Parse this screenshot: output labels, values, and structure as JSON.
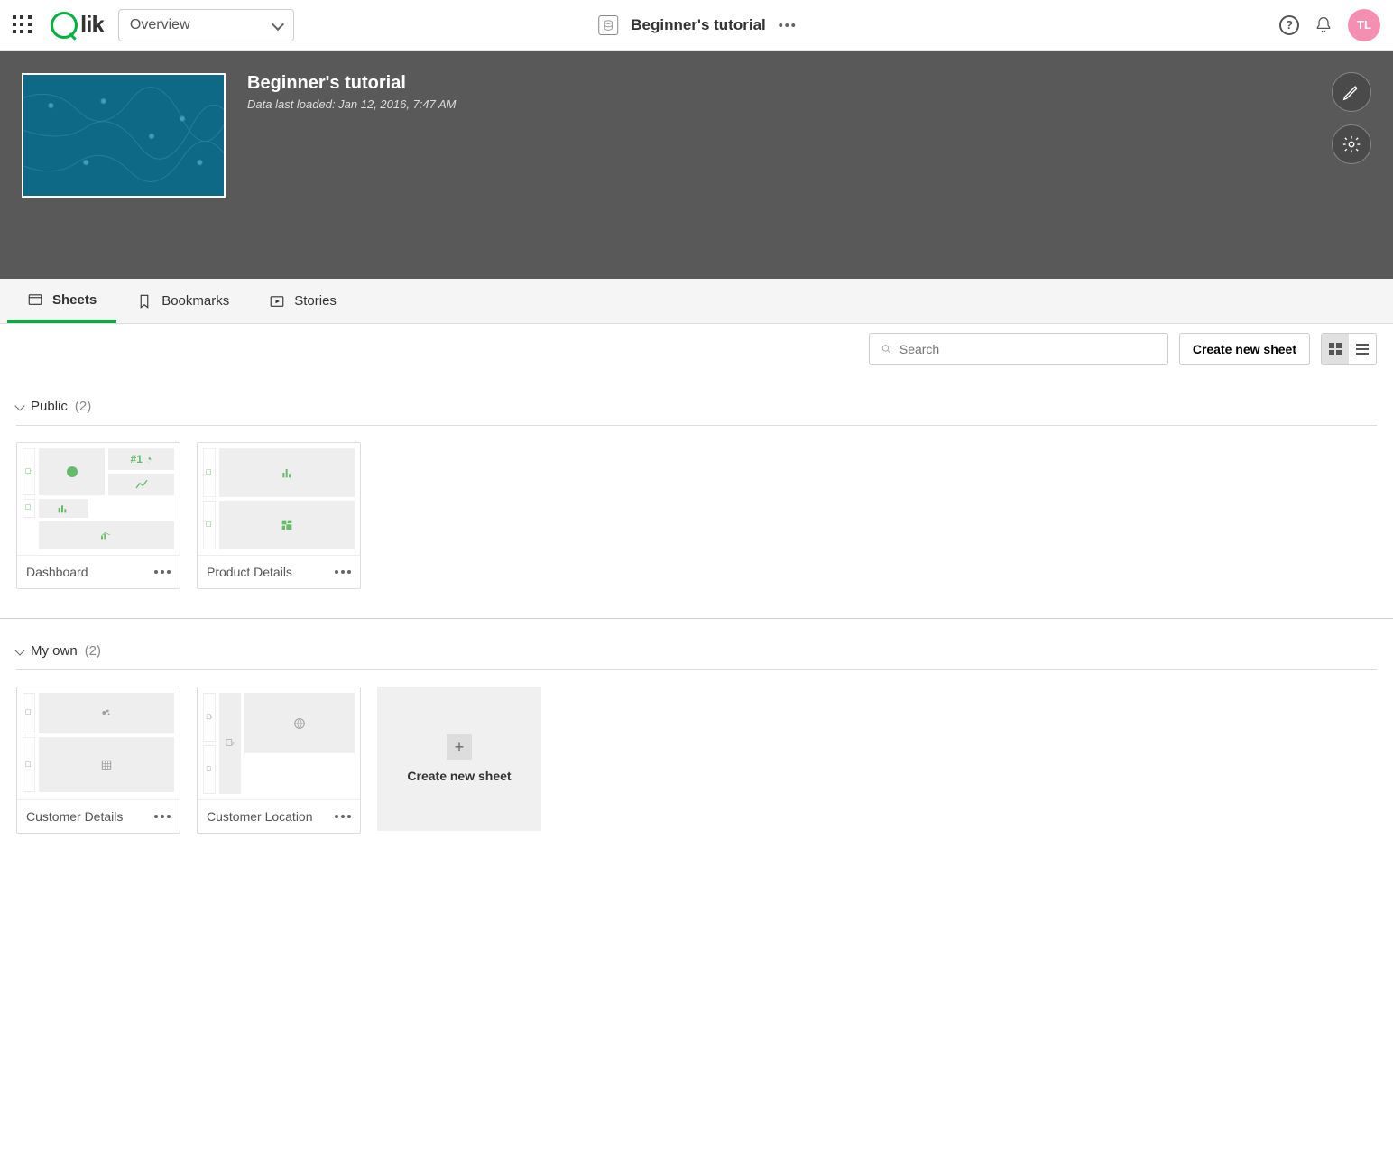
{
  "topbar": {
    "overview_label": "Overview",
    "app_name": "Beginner's tutorial",
    "avatar_initials": "TL"
  },
  "hero": {
    "title": "Beginner's tutorial",
    "subtitle": "Data last loaded: Jan 12, 2016, 7:47 AM"
  },
  "tabs": {
    "sheets": "Sheets",
    "bookmarks": "Bookmarks",
    "stories": "Stories"
  },
  "actions": {
    "search_placeholder": "Search",
    "create_button": "Create new sheet"
  },
  "sections": {
    "public": {
      "label": "Public",
      "count": "(2)"
    },
    "myown": {
      "label": "My own",
      "count": "(2)"
    }
  },
  "sheets": {
    "public": [
      {
        "name": "Dashboard"
      },
      {
        "name": "Product Details"
      }
    ],
    "myown": [
      {
        "name": "Customer Details"
      },
      {
        "name": "Customer Location"
      }
    ]
  },
  "newcard": {
    "label": "Create new sheet"
  }
}
